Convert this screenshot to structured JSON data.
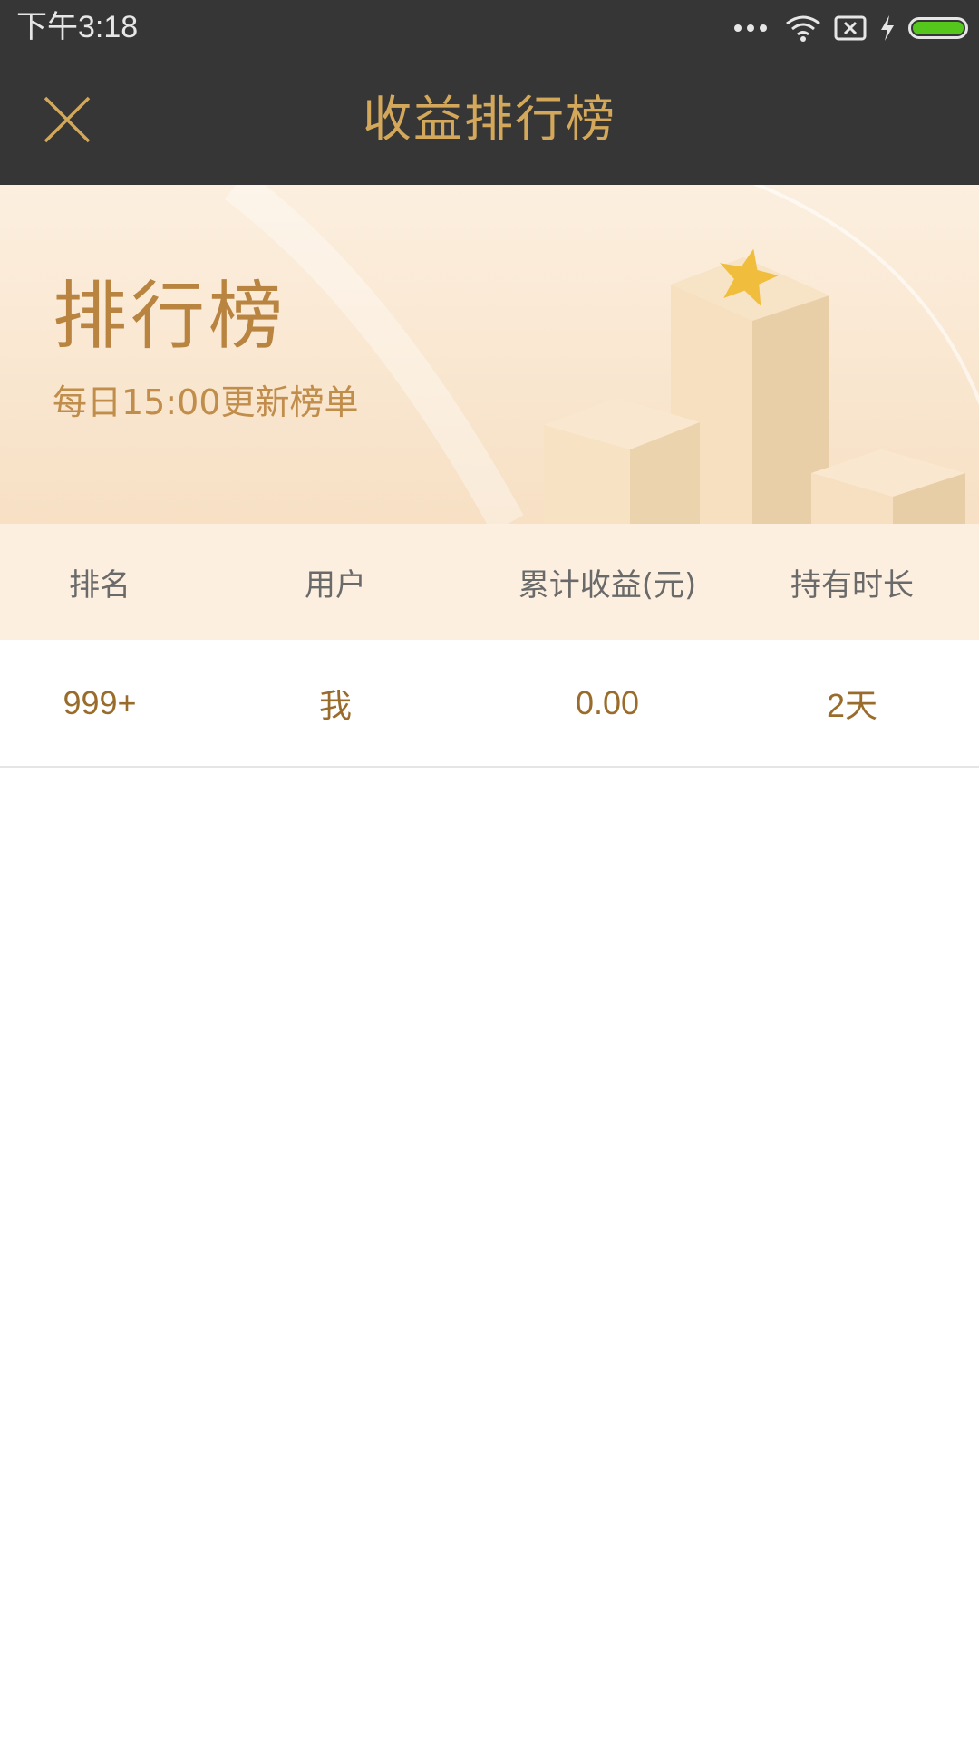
{
  "status_bar": {
    "time": "下午3:18",
    "battery_level": 1.0,
    "icons": [
      "more-dots-icon",
      "wifi-icon",
      "sim-x-icon",
      "charging-bolt-icon",
      "battery-icon"
    ],
    "battery_color": "#55c61b"
  },
  "header": {
    "title": "收益排行榜",
    "close_icon": "close-icon",
    "accent_color": "#d4a85a"
  },
  "banner": {
    "title": "排行榜",
    "subtitle": "每日15:00更新榜单",
    "art_icon": "podium-star-icon"
  },
  "table": {
    "columns": [
      "排名",
      "用户",
      "累计收益(元)",
      "持有时长"
    ],
    "rows": [
      {
        "rank": "999+",
        "user": "我",
        "earnings": "0.00",
        "duration": "2天"
      }
    ]
  }
}
